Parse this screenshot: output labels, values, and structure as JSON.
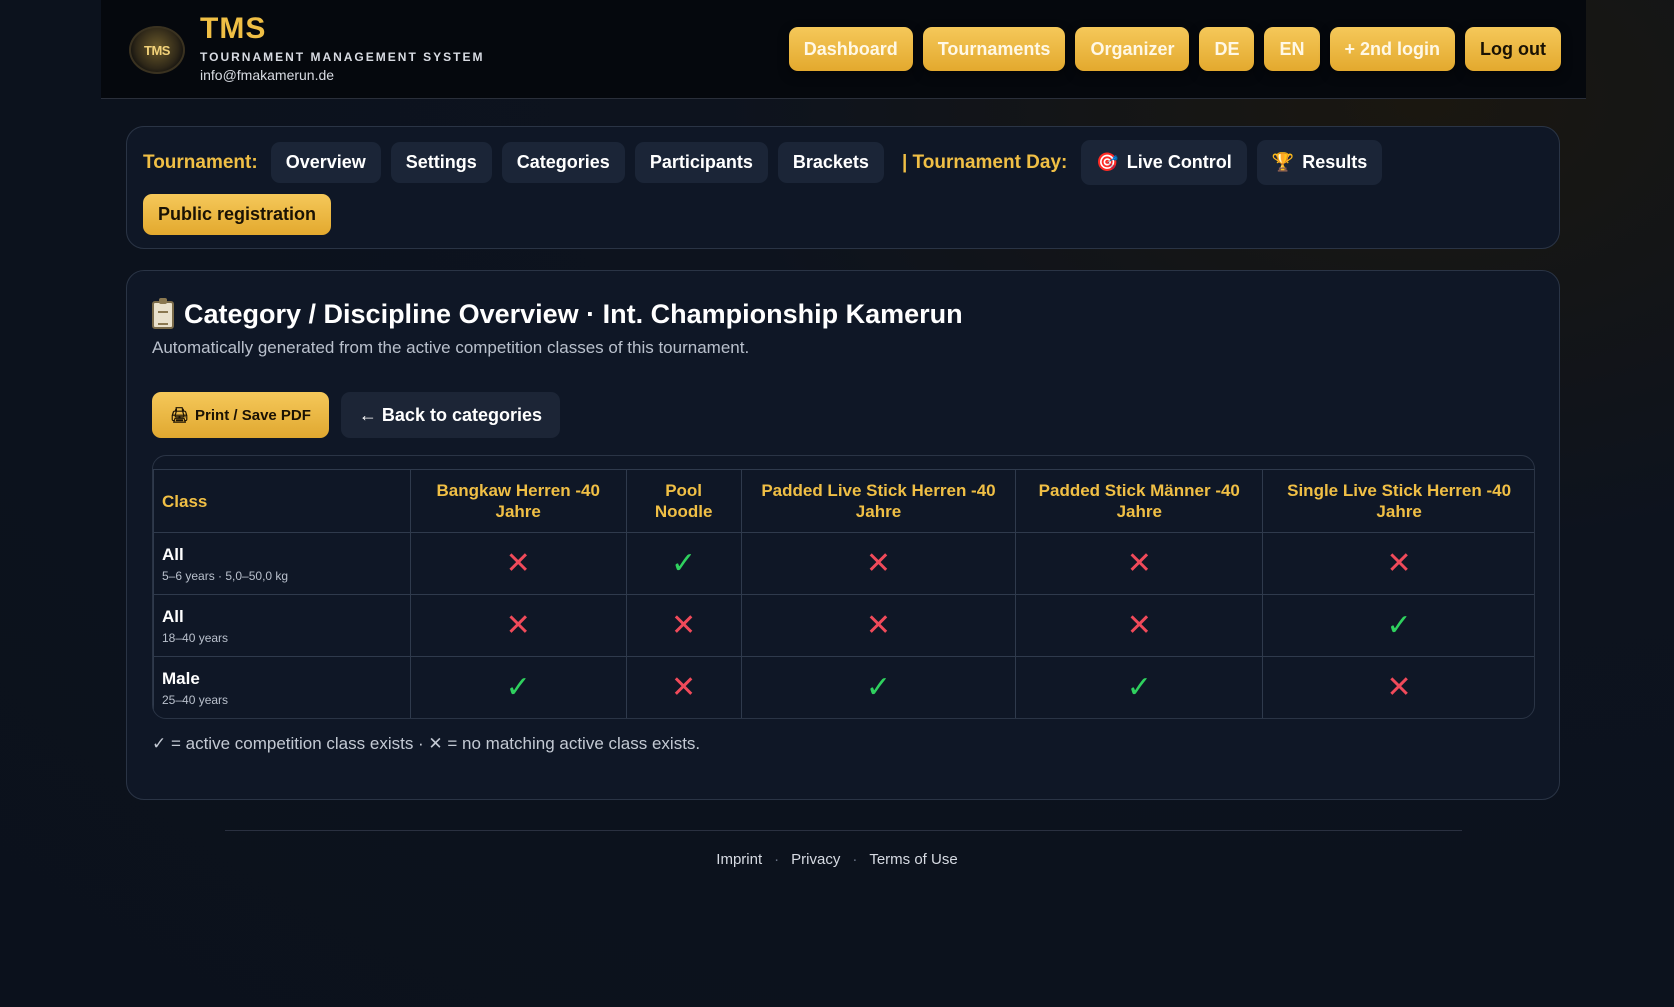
{
  "header": {
    "logo_text": "TMS",
    "title": "TMS",
    "subtitle": "TOURNAMENT MANAGEMENT SYSTEM",
    "email": "info@fmakamerun.de",
    "nav": {
      "dashboard": "Dashboard",
      "tournaments": "Tournaments",
      "organizer": "Organizer",
      "de": "DE",
      "en": "EN",
      "second_login": "+ 2nd login",
      "logout": "Log out"
    }
  },
  "tabs": {
    "tournament_label": "Tournament:",
    "overview": "Overview",
    "settings": "Settings",
    "categories": "Categories",
    "participants": "Participants",
    "brackets": "Brackets",
    "day_label": "| Tournament Day:",
    "live_icon": "🎯",
    "live_control": "Live Control",
    "results_icon": "🏆",
    "results": "Results",
    "public_registration": "Public registration"
  },
  "main": {
    "title": "Category / Discipline Overview · Int. Championship Kamerun",
    "subtitle": "Automatically generated from the active competition classes of this tournament.",
    "print_icon": "🖨",
    "print_label": "Print / Save PDF",
    "back_label": "← Back to categories",
    "table": {
      "col_class": "Class",
      "columns": [
        "Bangkaw Herren -40 Jahre",
        "Pool Noodle",
        "Padded Live Stick Herren -40 Jahre",
        "Padded Stick Männer -40 Jahre",
        "Single Live Stick Herren -40 Jahre"
      ],
      "rows": [
        {
          "name": "All",
          "meta": "5–6 years · 5,0–50,0 kg",
          "cells": [
            "✕",
            "✓",
            "✕",
            "✕",
            "✕"
          ]
        },
        {
          "name": "All",
          "meta": "18–40 years",
          "cells": [
            "✕",
            "✕",
            "✕",
            "✕",
            "✓"
          ]
        },
        {
          "name": "Male",
          "meta": "25–40 years",
          "cells": [
            "✓",
            "✕",
            "✓",
            "✓",
            "✕"
          ]
        }
      ]
    },
    "legend": "✓ = active competition class exists · ✕ = no matching active class exists."
  },
  "footer": {
    "imprint": "Imprint",
    "privacy": "Privacy",
    "terms": "Terms of Use",
    "separator": "·"
  },
  "colors": {
    "accent": "#f0bf45",
    "yes": "#2fd15e",
    "no": "#f04a5a",
    "panel": "#0f1726"
  }
}
